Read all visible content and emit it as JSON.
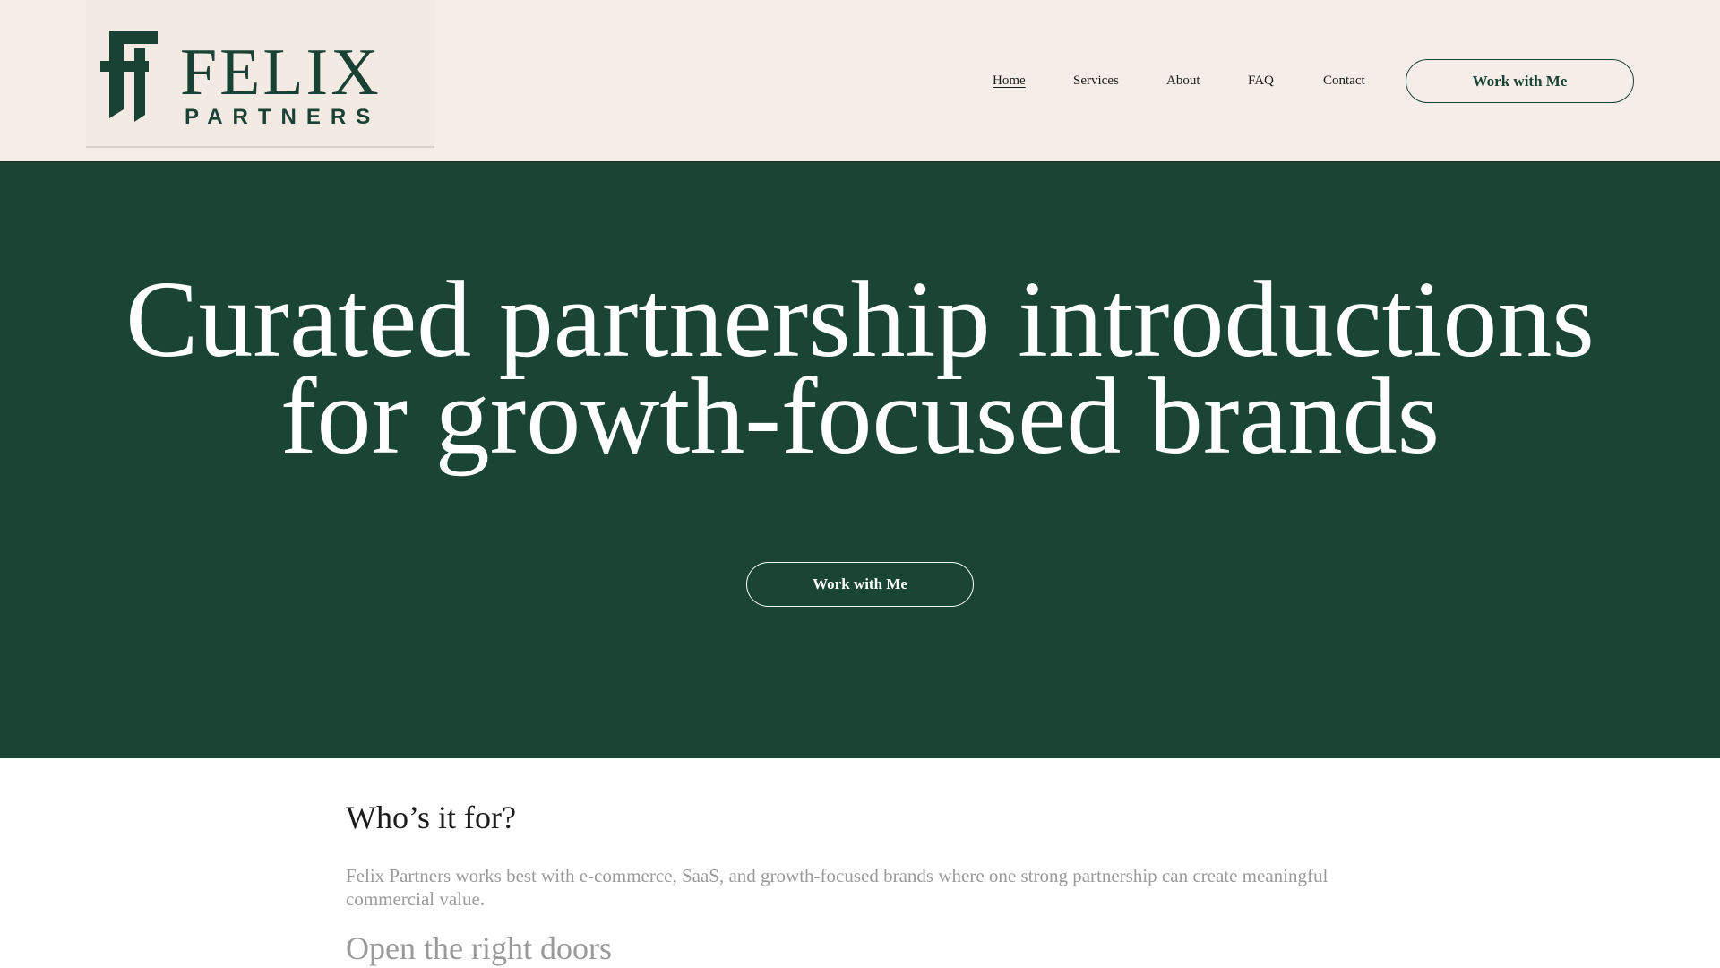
{
  "brand": {
    "name": "FELIX",
    "tagline": "PARTNERS",
    "primary_color": "#1a4535",
    "header_bg": "#f5eee8"
  },
  "nav": {
    "items": [
      {
        "label": "Home",
        "active": true
      },
      {
        "label": "Services",
        "active": false
      },
      {
        "label": "About",
        "active": false
      },
      {
        "label": "FAQ",
        "active": false
      },
      {
        "label": "Contact",
        "active": false
      }
    ],
    "cta_label": "Work with Me"
  },
  "hero": {
    "title_line1": "Curated partnership introductions",
    "title_line2": "for growth-focused brands",
    "cta_label": "Work with Me"
  },
  "who": {
    "heading": "Who’s it for?",
    "body": "Felix Partners works best with e-commerce, SaaS, and growth-focused brands where one strong partnership can create meaningful commercial value.",
    "next_heading": "Open the right doors"
  }
}
